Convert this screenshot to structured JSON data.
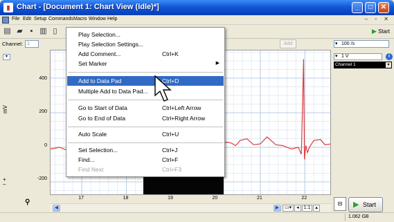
{
  "window": {
    "title": "Chart - [Document 1: Chart View (Idle)*]",
    "app_icon": "chart-app-icon"
  },
  "menubar": {
    "items": [
      "File",
      "Edit",
      "Setup",
      "Commands",
      "Macro",
      "Window",
      "Help"
    ]
  },
  "toolbar": {
    "start_label": "Start"
  },
  "channel_row": {
    "channel_label": "Channel:",
    "channel_value": "1",
    "add_label": "Add",
    "rate_value": "100 /s"
  },
  "y_axis": {
    "unit": "mV",
    "ticks": [
      "400",
      "200",
      "0",
      "-200"
    ]
  },
  "x_axis": {
    "ticks": [
      "17",
      "18",
      "19",
      "20",
      "21",
      "22"
    ]
  },
  "right_panel": {
    "range_value": "1 V",
    "channel_name": "Channel 1"
  },
  "context_menu": {
    "items": [
      {
        "label": "Play Selection...",
        "shortcut": ""
      },
      {
        "label": "Play Selection Settings...",
        "shortcut": ""
      },
      {
        "label": "Add Comment...",
        "shortcut": "Ctrl+K"
      },
      {
        "label": "Set Marker",
        "shortcut": ""
      },
      {
        "label": "Add to Data Pad",
        "shortcut": "Ctrl+D"
      },
      {
        "label": "Multiple Add to Data Pad...",
        "shortcut": ""
      },
      {
        "label": "Go to Start of Data",
        "shortcut": "Ctrl+Left Arrow"
      },
      {
        "label": "Go to End of Data",
        "shortcut": "Ctrl+Right Arrow"
      },
      {
        "label": "Auto Scale",
        "shortcut": "Ctrl+U"
      },
      {
        "label": "Set Selection...",
        "shortcut": "Ctrl+J"
      },
      {
        "label": "Find...",
        "shortcut": "Ctrl+F"
      },
      {
        "label": "Find Next",
        "shortcut": "Ctrl+F3"
      }
    ]
  },
  "bottom": {
    "zoom_label": "1:1",
    "start_label": "Start",
    "disk": "1.062 GB"
  },
  "colors": {
    "trace": "#e23a3a",
    "menu_highlight": "#316ac5",
    "title_blue": "#0a46c4"
  },
  "chart_data": {
    "type": "line",
    "title": "",
    "xlabel": "",
    "ylabel": "mV",
    "xlim": [
      16.3,
      22.6
    ],
    "ylim": [
      -280,
      560
    ],
    "x_ticks": [
      17,
      18,
      19,
      20,
      21,
      22
    ],
    "y_ticks": [
      -200,
      0,
      200,
      400
    ],
    "grid": true,
    "series": [
      {
        "x": [
          16.3,
          16.5,
          16.7,
          16.9,
          17.1,
          17.3,
          17.5,
          17.7,
          17.9,
          18.1,
          18.3,
          18.5,
          18.7,
          18.9,
          19.1,
          19.3,
          19.5,
          19.7,
          19.9,
          19.98,
          20.0,
          20.02,
          20.05,
          20.08,
          20.12,
          20.25,
          20.35,
          20.45,
          20.55,
          20.7,
          20.85,
          21.0,
          21.15,
          21.35,
          21.5,
          21.7,
          21.85,
          21.92,
          21.97,
          21.99,
          22.02,
          22.06,
          22.1,
          22.2,
          22.35,
          22.45,
          22.6
        ],
        "y": [
          -10,
          0,
          -20,
          5,
          -15,
          10,
          -5,
          0,
          -10,
          5,
          -20,
          0,
          10,
          -5,
          0,
          15,
          -10,
          5,
          0,
          -40,
          500,
          -60,
          10,
          -20,
          20,
          30,
          25,
          10,
          40,
          50,
          15,
          20,
          60,
          15,
          10,
          -10,
          0,
          -40,
          510,
          -70,
          10,
          -30,
          0,
          40,
          45,
          15,
          20
        ]
      }
    ]
  }
}
